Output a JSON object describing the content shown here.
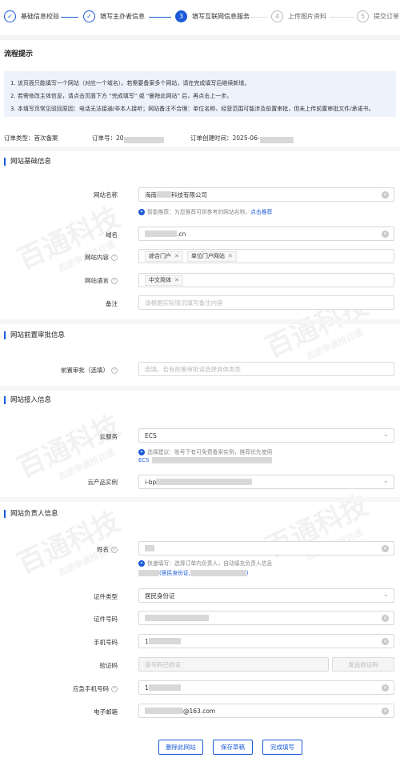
{
  "steps": [
    {
      "num": "✓",
      "label": "基础信息校验"
    },
    {
      "num": "✓",
      "label": "填写主办者信息"
    },
    {
      "num": "3",
      "label": "填写互联网信息服务"
    },
    {
      "num": "4",
      "label": "上传图片资料"
    },
    {
      "num": "5",
      "label": "提交订单"
    }
  ],
  "flow": {
    "title": "流程提示",
    "notes": [
      "1. 该页面只能填写一个网站（对应一个域名）。若需要备案多个网站，请在完成填写后继续新增。",
      "2. 若需修改主体信息，请点击页面下方 “完成填写” 或 “删除此网站” 后，再点击上一步。",
      "3. 本填写页常见驳回原因：电话无法接通/非本人接听；网站备注不合理：单位名称、经营范围可能涉及前置审批，但未上传前置审批文件/承诺书。"
    ]
  },
  "order": {
    "type_label": "订单类型：首次备案",
    "num_label": "订单号：20",
    "time_label": "订单创建时间：2025-06-"
  },
  "sections": {
    "basic": "网站基础信息",
    "preapproval": "网站前置审批信息",
    "access": "网站接入信息",
    "owner": "网站负责人信息"
  },
  "basic": {
    "name_label": "网站名称",
    "name_prefix": "海南",
    "name_suffix": "科技有限公司",
    "name_hint": "智能推荐：为您推荐可供参考的网站名称。",
    "name_hint_link": "点击推荐",
    "domain_label": "域名",
    "domain_suffix": ".cn",
    "content_label": "网站内容",
    "content_tags": [
      "综合门户",
      "单位门户网站"
    ],
    "lang_label": "网站语言",
    "lang_tags": [
      "中文简体"
    ],
    "remark_label": "备注",
    "remark_placeholder": "请根据实际情况填写备注内容"
  },
  "preapproval": {
    "label": "前置审批（选填）",
    "placeholder": "选填。若有前置审批请选择具体类型"
  },
  "access": {
    "cloud_label": "云服务",
    "cloud_value": "ECS",
    "cloud_hint": "选择建议：账号下有可免费备案实例，推荐优先使用",
    "cloud_hint_link": "ECS",
    "instance_label": "云产品实例",
    "instance_prefix": "i-bp"
  },
  "owner": {
    "name_label": "姓名",
    "name_hint": "快速填写：选择订单内负责人，自动填充负责人信息",
    "name_hint_link": "(居民身份证,",
    "name_hint_link_end": ")",
    "idtype_label": "证件类型",
    "idtype_value": "居民身份证",
    "idnum_label": "证件号码",
    "phone_label": "手机号码",
    "phone_prefix": "1",
    "code_label": "验证码",
    "code_placeholder": "该号码已验证",
    "code_button": "发送验证码",
    "emerg_label": "应急手机号码",
    "emerg_prefix": "1",
    "email_label": "电子邮箱",
    "email_suffix": "@163.com"
  },
  "buttons": {
    "delete": "删除此网站",
    "save": "保存草稿",
    "finish": "完成填写"
  },
  "watermark": {
    "text": "百通科技",
    "sub": "资质申请找百通"
  },
  "icons": {
    "clear": "clear-icon",
    "chevron": "chevron-down-icon",
    "help": "help-icon",
    "tag_remove": "close-icon"
  }
}
